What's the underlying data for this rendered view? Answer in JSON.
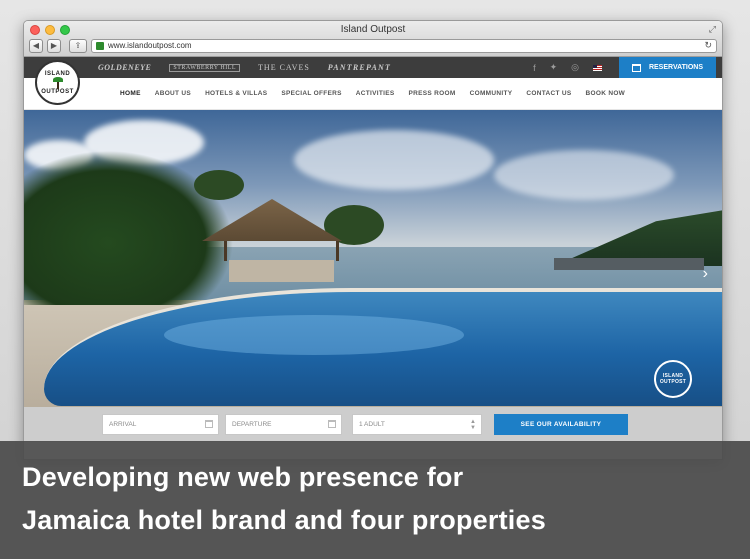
{
  "window": {
    "title": "Island Outpost"
  },
  "browser": {
    "url": "www.islandoutpost.com"
  },
  "site": {
    "logo_top": "ISLAND",
    "logo_bottom": "OUTPOST",
    "properties": [
      "GOLDENEYE",
      "STRAWBERRY HILL",
      "THE CAVES",
      "PANTREPANT"
    ],
    "reservations_label": "RESERVATIONS",
    "nav": [
      "HOME",
      "ABOUT US",
      "HOTELS & VILLAS",
      "SPECIAL OFFERS",
      "ACTIVITIES",
      "PRESS ROOM",
      "COMMUNITY",
      "CONTACT US",
      "BOOK NOW"
    ],
    "booking": {
      "arrival_placeholder": "ARRIVAL",
      "departure_placeholder": "DEPARTURE",
      "guests_value": "1 ADULT",
      "availability_label": "SEE OUR AVAILABILITY"
    },
    "accent_color": "#1d7fc7"
  },
  "caption": {
    "line1": "Developing new web presence for",
    "line2": "Jamaica hotel brand and four properties"
  }
}
